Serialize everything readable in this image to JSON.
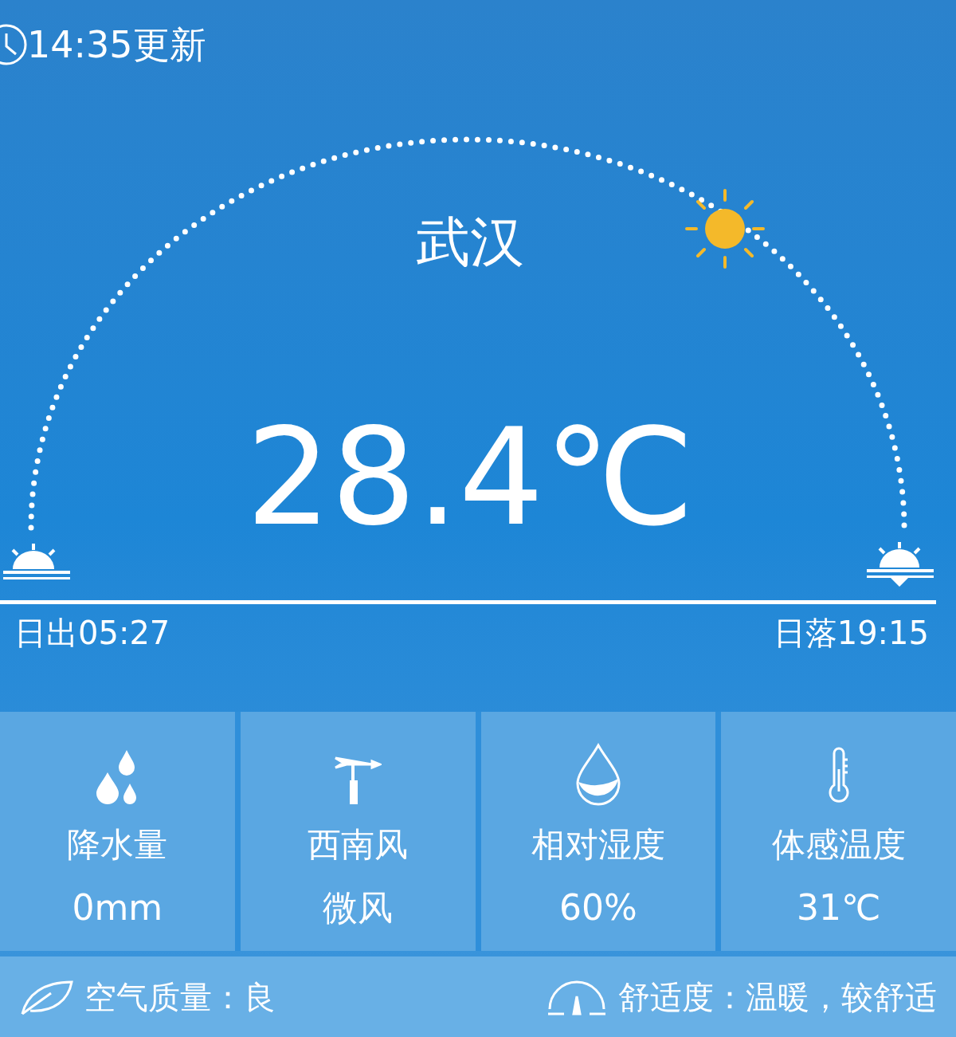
{
  "updated": "14:35更新",
  "city": "武汉",
  "temperature": "28.4℃",
  "sunrise": "日出05:27",
  "sunset": "日落19:15",
  "tiles": [
    {
      "kind": "rain",
      "label": "降水量",
      "value": "0mm"
    },
    {
      "kind": "wind",
      "label": "西南风",
      "value": "微风"
    },
    {
      "kind": "humidity",
      "label": "相对湿度",
      "value": "60%"
    },
    {
      "kind": "feels",
      "label": "体感温度",
      "value": "31℃"
    }
  ],
  "air_quality": "空气质量：良",
  "comfort": "舒适度：温暖，较舒适"
}
